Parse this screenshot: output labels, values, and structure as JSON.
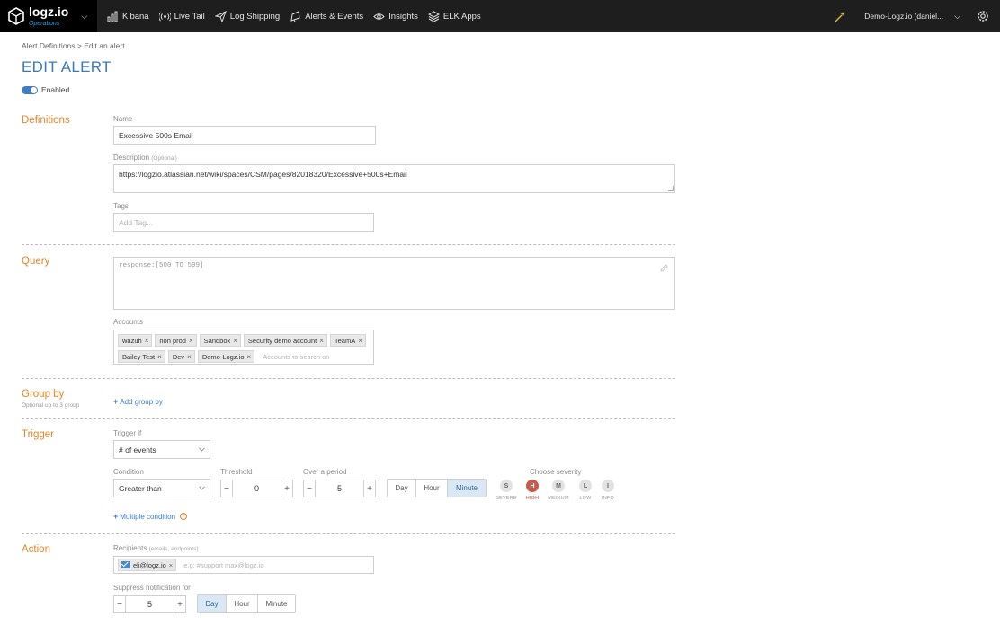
{
  "nav": {
    "logo_name": "logz.io",
    "logo_sub": "Operations",
    "items": [
      {
        "label": "Kibana",
        "icon": "bar-chart-icon"
      },
      {
        "label": "Live Tail",
        "icon": "live-tail-icon"
      },
      {
        "label": "Log Shipping",
        "icon": "paper-plane-icon"
      },
      {
        "label": "Alerts & Events",
        "icon": "bell-icon"
      },
      {
        "label": "Insights",
        "icon": "eye-icon"
      },
      {
        "label": "ELK Apps",
        "icon": "layers-icon"
      }
    ],
    "account": "Demo-Logz.io (daniel..."
  },
  "breadcrumb": "Alert Definitions > Edit an alert",
  "title": "EDIT ALERT",
  "enabled_label": "Enabled",
  "definitions": {
    "section": "Definitions",
    "name_label": "Name",
    "name_value": "Excessive 500s Email",
    "desc_label": "Description",
    "desc_optional": "(Optional)",
    "desc_value": "https://logzio.atlassian.net/wiki/spaces/CSM/pages/82018320/Excessive+500s+Email",
    "tags_label": "Tags",
    "tags_placeholder": "Add Tag..."
  },
  "query": {
    "section": "Query",
    "value": "response:[500 TO 599]",
    "accounts_label": "Accounts",
    "accounts": [
      "wazuh",
      "non prod",
      "Sandbox",
      "Security demo account",
      "TeamA",
      "Bailey Test",
      "Dev",
      "Demo-Logz.io"
    ],
    "accounts_placeholder": "Accounts to search on"
  },
  "group_by": {
    "section": "Group by",
    "sub": "Optional up to 3 group",
    "add_label": "Add group by"
  },
  "trigger": {
    "section": "Trigger",
    "trigger_if_label": "Trigger if",
    "trigger_if_value": "# of events",
    "condition_label": "Condition",
    "condition_value": "Greater than",
    "threshold_label": "Threshold",
    "threshold_value": "0",
    "period_label": "Over a period",
    "period_value": "5",
    "period_units": [
      "Day",
      "Hour",
      "Minute"
    ],
    "period_selected": "Minute",
    "severity_label": "Choose severity",
    "severities": [
      {
        "letter": "S",
        "name": "SEVERE"
      },
      {
        "letter": "H",
        "name": "HIGH"
      },
      {
        "letter": "M",
        "name": "MEDIUM"
      },
      {
        "letter": "L",
        "name": "LOW"
      },
      {
        "letter": "I",
        "name": "INFO"
      }
    ],
    "severity_selected": "HIGH",
    "multiple_label": "Multiple condition"
  },
  "action": {
    "section": "Action",
    "recipients_label": "Recipients",
    "recipients_hint": "(emails, endpoints)",
    "recipient": "eli@logz.io",
    "recipients_placeholder": "e.g:  #support  max@logz.io",
    "suppress_label": "Suppress notification for",
    "suppress_value": "5",
    "suppress_units": [
      "Day",
      "Hour",
      "Minute"
    ],
    "suppress_selected": "Day"
  },
  "colors": {
    "accent": "#3f7cc0",
    "section": "#e1862d",
    "severity_high": "#c85a4c",
    "nav_bg": "#1e1e1e"
  }
}
